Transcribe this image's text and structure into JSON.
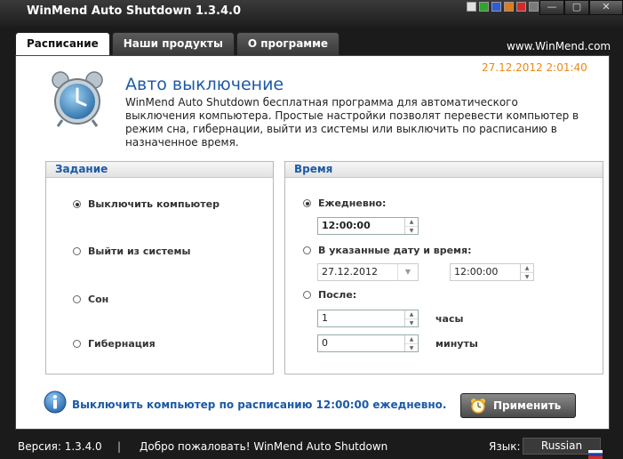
{
  "window": {
    "title": "WinMend Auto Shutdown 1.3.4.0",
    "controls": {
      "minimize": "—",
      "maximize": "▢",
      "close": "✕"
    },
    "skin_colors": [
      "#e0e0e0",
      "#2ea52e",
      "#2e5cd6",
      "#e07a1a",
      "#d62a2a",
      "#7a7a7a"
    ]
  },
  "tabs": [
    {
      "label": "Расписание",
      "active": true
    },
    {
      "label": "Наши продукты",
      "active": false
    },
    {
      "label": "О программе",
      "active": false
    }
  ],
  "site_link": "www.WinMend.com",
  "header": {
    "datetime": "27.12.2012 2:01:40",
    "title": "Авто выключение",
    "description": "WinMend Auto Shutdown бесплатная программа для автоматического выключения компьютера. Простые настройки позволят перевести компьютер в режим сна, гибернации, выйти из системы или выключить по расписанию в назначенное время."
  },
  "task_group": {
    "title": "Задание",
    "options": [
      {
        "label": "Выключить компьютер",
        "selected": true
      },
      {
        "label": "Выйти из системы",
        "selected": false
      },
      {
        "label": "Сон",
        "selected": false
      },
      {
        "label": "Гибернация",
        "selected": false
      }
    ]
  },
  "time_group": {
    "title": "Время",
    "daily": {
      "label": "Ежедневно:",
      "selected": true,
      "time": "12:00:00"
    },
    "specific": {
      "label": "В указанные дату и время:",
      "selected": false,
      "date": "27.12.2012",
      "time": "12:00:00"
    },
    "after": {
      "label": "После:",
      "selected": false,
      "hours": "1",
      "hours_unit": "часы",
      "minutes": "0",
      "minutes_unit": "минуты"
    }
  },
  "footer": {
    "status_message": "Выключить компьютер по расписанию 12:00:00 ежедневно.",
    "apply_label": "Применить"
  },
  "statusbar": {
    "version": "Версия: 1.3.4.0",
    "separator": "|",
    "welcome": "Добро пожаловать! WinMend Auto Shutdown",
    "language_label": "Язык:",
    "language_value": "Russian"
  },
  "icons": {
    "main": "alarm-clock-icon",
    "info": "info-icon",
    "apply": "alarm-clock-icon",
    "flag": "russia-flag-icon"
  }
}
